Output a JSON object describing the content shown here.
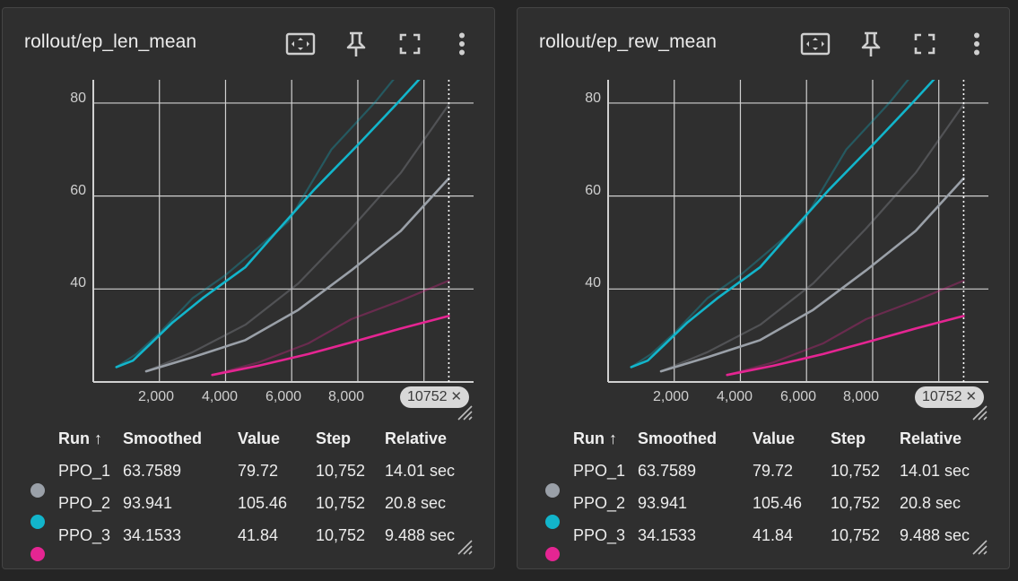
{
  "panels": [
    {
      "title": "rollout/ep_len_mean",
      "x_ticks": [
        "2,000",
        "4,000",
        "6,000",
        "8,000"
      ],
      "y_ticks": [
        "80",
        "60",
        "40"
      ],
      "cursor_step": "10752",
      "legend": {
        "headers": {
          "run": "Run",
          "sort_icon": "↑",
          "smoothed": "Smoothed",
          "value": "Value",
          "step": "Step",
          "relative": "Relative"
        },
        "rows": [
          {
            "run": "PPO_1",
            "smoothed": "63.7589",
            "value": "79.72",
            "step": "10,752",
            "relative": "14.01 sec",
            "color": "#9aa0a8"
          },
          {
            "run": "PPO_2",
            "smoothed": "93.941",
            "value": "105.46",
            "step": "10,752",
            "relative": "20.8 sec",
            "color": "#12b5cb"
          },
          {
            "run": "PPO_3",
            "smoothed": "34.1533",
            "value": "41.84",
            "step": "10,752",
            "relative": "9.488 sec",
            "color": "#e52592"
          }
        ]
      }
    },
    {
      "title": "rollout/ep_rew_mean",
      "x_ticks": [
        "2,000",
        "4,000",
        "6,000",
        "8,000"
      ],
      "y_ticks": [
        "80",
        "60",
        "40"
      ],
      "cursor_step": "10752",
      "legend": {
        "headers": {
          "run": "Run",
          "sort_icon": "↑",
          "smoothed": "Smoothed",
          "value": "Value",
          "step": "Step",
          "relative": "Relative"
        },
        "rows": [
          {
            "run": "PPO_1",
            "smoothed": "63.7589",
            "value": "79.72",
            "step": "10,752",
            "relative": "14.01 sec",
            "color": "#9aa0a8"
          },
          {
            "run": "PPO_2",
            "smoothed": "93.941",
            "value": "105.46",
            "step": "10,752",
            "relative": "20.8 sec",
            "color": "#12b5cb"
          },
          {
            "run": "PPO_3",
            "smoothed": "34.1533",
            "value": "41.84",
            "step": "10,752",
            "relative": "9.488 sec",
            "color": "#e52592"
          }
        ]
      }
    }
  ],
  "chart_data": [
    {
      "type": "line",
      "xlim": [
        0,
        11500
      ],
      "ylim": [
        20,
        85
      ],
      "grid": true,
      "series": [
        {
          "name": "PPO_1",
          "smoothed": true,
          "color": "#9aa0a8",
          "x": [
            1600,
            3000,
            4600,
            6200,
            7800,
            9300,
            10752
          ],
          "y": [
            22.3,
            25.3,
            29,
            35.5,
            44,
            52.5,
            63.8
          ]
        },
        {
          "name": "PPO_1",
          "smoothed": false,
          "color": "#9aa0a8",
          "x": [
            1600,
            3000,
            4600,
            6200,
            7800,
            9300,
            10752
          ],
          "y": [
            22.3,
            26.4,
            32.3,
            41.2,
            53,
            65,
            79.7
          ]
        },
        {
          "name": "PPO_2",
          "smoothed": true,
          "color": "#12b5cb",
          "x": [
            700,
            1200,
            1700,
            2400,
            3300,
            4600,
            5500,
            6700,
            8000,
            9200,
            10100
          ],
          "y": [
            23.2,
            24.6,
            28,
            32.8,
            38,
            44.7,
            52,
            61.5,
            71,
            80,
            87
          ]
        },
        {
          "name": "PPO_2",
          "smoothed": false,
          "color": "#12b5cb",
          "x": [
            700,
            1300,
            2000,
            3000,
            4000,
            5000,
            5900,
            7200,
            8500,
            9300
          ],
          "y": [
            23.2,
            26,
            30.5,
            38,
            43,
            49,
            54.5,
            70,
            80,
            87
          ]
        },
        {
          "name": "PPO_3",
          "smoothed": true,
          "color": "#e52592",
          "x": [
            3600,
            5000,
            6500,
            7800,
            9300,
            10752
          ],
          "y": [
            21.5,
            23.5,
            26,
            28.5,
            31.5,
            34.2
          ]
        },
        {
          "name": "PPO_3",
          "smoothed": false,
          "color": "#e52592",
          "x": [
            3600,
            5000,
            6500,
            7800,
            9300,
            10752
          ],
          "y": [
            21.5,
            24.2,
            28.3,
            33.5,
            37.5,
            41.8
          ]
        }
      ],
      "cursor_x": 10752
    },
    {
      "type": "line",
      "xlim": [
        0,
        11500
      ],
      "ylim": [
        20,
        85
      ],
      "grid": true,
      "series": [
        {
          "name": "PPO_1",
          "smoothed": true,
          "color": "#9aa0a8",
          "x": [
            1600,
            3000,
            4600,
            6200,
            7800,
            9300,
            10752
          ],
          "y": [
            22.3,
            25.3,
            29,
            35.5,
            44,
            52.5,
            63.8
          ]
        },
        {
          "name": "PPO_1",
          "smoothed": false,
          "color": "#9aa0a8",
          "x": [
            1600,
            3000,
            4600,
            6200,
            7800,
            9300,
            10752
          ],
          "y": [
            22.3,
            26.4,
            32.3,
            41.2,
            53,
            65,
            79.7
          ]
        },
        {
          "name": "PPO_2",
          "smoothed": true,
          "color": "#12b5cb",
          "x": [
            700,
            1200,
            1700,
            2400,
            3300,
            4600,
            5500,
            6700,
            8000,
            9200,
            10100
          ],
          "y": [
            23.2,
            24.6,
            28,
            32.8,
            38,
            44.7,
            52,
            61.5,
            71,
            80,
            87
          ]
        },
        {
          "name": "PPO_2",
          "smoothed": false,
          "color": "#12b5cb",
          "x": [
            700,
            1300,
            2000,
            3000,
            4000,
            5000,
            5900,
            7200,
            8500,
            9300
          ],
          "y": [
            23.2,
            26,
            30.5,
            38,
            43,
            49,
            54.5,
            70,
            80,
            87
          ]
        },
        {
          "name": "PPO_3",
          "smoothed": true,
          "color": "#e52592",
          "x": [
            3600,
            5000,
            6500,
            7800,
            9300,
            10752
          ],
          "y": [
            21.5,
            23.5,
            26,
            28.5,
            31.5,
            34.2
          ]
        },
        {
          "name": "PPO_3",
          "smoothed": false,
          "color": "#e52592",
          "x": [
            3600,
            5000,
            6500,
            7800,
            9300,
            10752
          ],
          "y": [
            21.5,
            24.2,
            28.3,
            33.5,
            37.5,
            41.8
          ]
        }
      ],
      "cursor_x": 10752
    }
  ]
}
